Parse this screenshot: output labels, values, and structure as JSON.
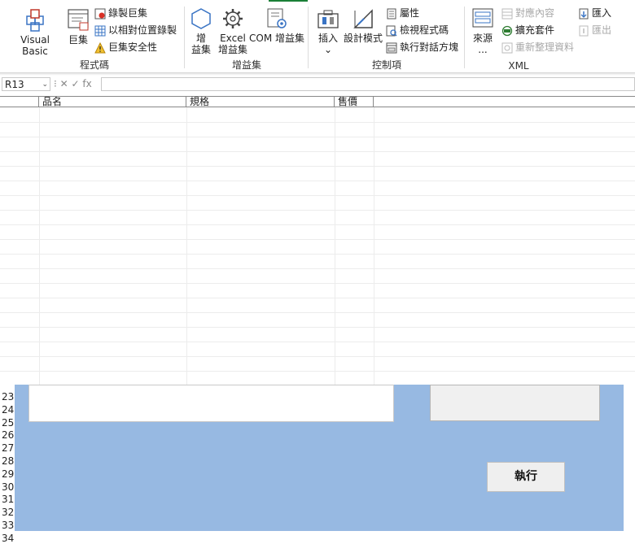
{
  "ribbon": {
    "code_group": {
      "label": "程式碼",
      "visual_basic": "Visual Basic",
      "macros": "巨集",
      "record_macro": "錄製巨集",
      "relative_refs": "以相對位置錄製",
      "macro_security": "巨集安全性"
    },
    "addins_group": {
      "label": "增益集",
      "addins_line1": "增",
      "addins_line2": "益集",
      "excel_addins_line1": "Excel",
      "excel_addins_line2": "增益集",
      "com_addins": "COM 增益集"
    },
    "controls_group": {
      "label": "控制項",
      "insert": "插入",
      "insert_arrow": "⌄",
      "design_mode": "設計模式",
      "properties": "屬性",
      "view_code": "檢視程式碼",
      "run_dialog": "執行對話方塊"
    },
    "xml_group": {
      "label": "XML",
      "source_line1": "來源",
      "source_line2": "...",
      "map_properties": "對應內容",
      "expansion_packs": "擴充套件",
      "refresh_data": "重新整理資料",
      "import": "匯入",
      "export": "匯出"
    }
  },
  "formula_bar": {
    "name_box": "R13",
    "name_box_arrow": "⌄",
    "fx_controls": "⁝  ✕  ✓  fx",
    "formula_value": ""
  },
  "sheet": {
    "headers": [
      "品名",
      "規格",
      "售價"
    ]
  },
  "row_numbers": [
    "23",
    "24",
    "25",
    "26",
    "27",
    "28",
    "29",
    "30",
    "31",
    "32",
    "33",
    "34"
  ],
  "form": {
    "run_button": "執行"
  }
}
